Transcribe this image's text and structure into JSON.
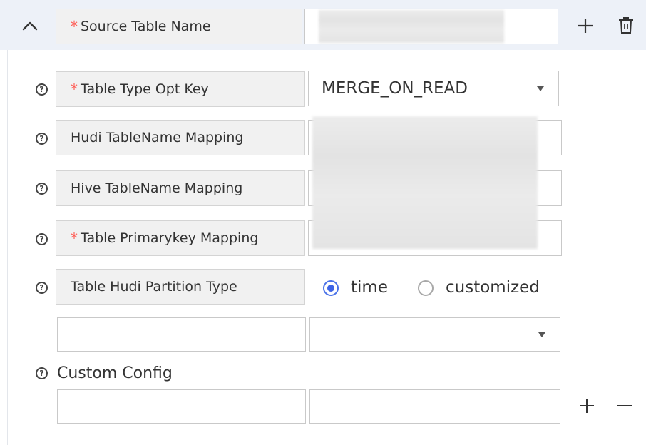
{
  "header": {
    "source_table_label": "Source Table Name"
  },
  "fields": {
    "table_type_label": "Table Type Opt Key",
    "table_type_value": "MERGE_ON_READ",
    "hudi_mapping_label": "Hudi TableName Mapping",
    "hive_mapping_label": "Hive TableName Mapping",
    "primarykey_label": "Table Primarykey Mapping",
    "partition_type_label": "Table Hudi Partition Type",
    "partition_options": [
      "time",
      "customized"
    ],
    "custom_config_label": "Custom Config"
  },
  "colors": {
    "accent": "#3e64e6",
    "required": "#ff5a52",
    "header_bg": "#edf1f8"
  },
  "icons": {
    "collapse": "chevron-up-icon",
    "add": "plus-icon",
    "delete": "trash-icon",
    "help": "question-circle-icon",
    "remove": "minus-icon"
  }
}
